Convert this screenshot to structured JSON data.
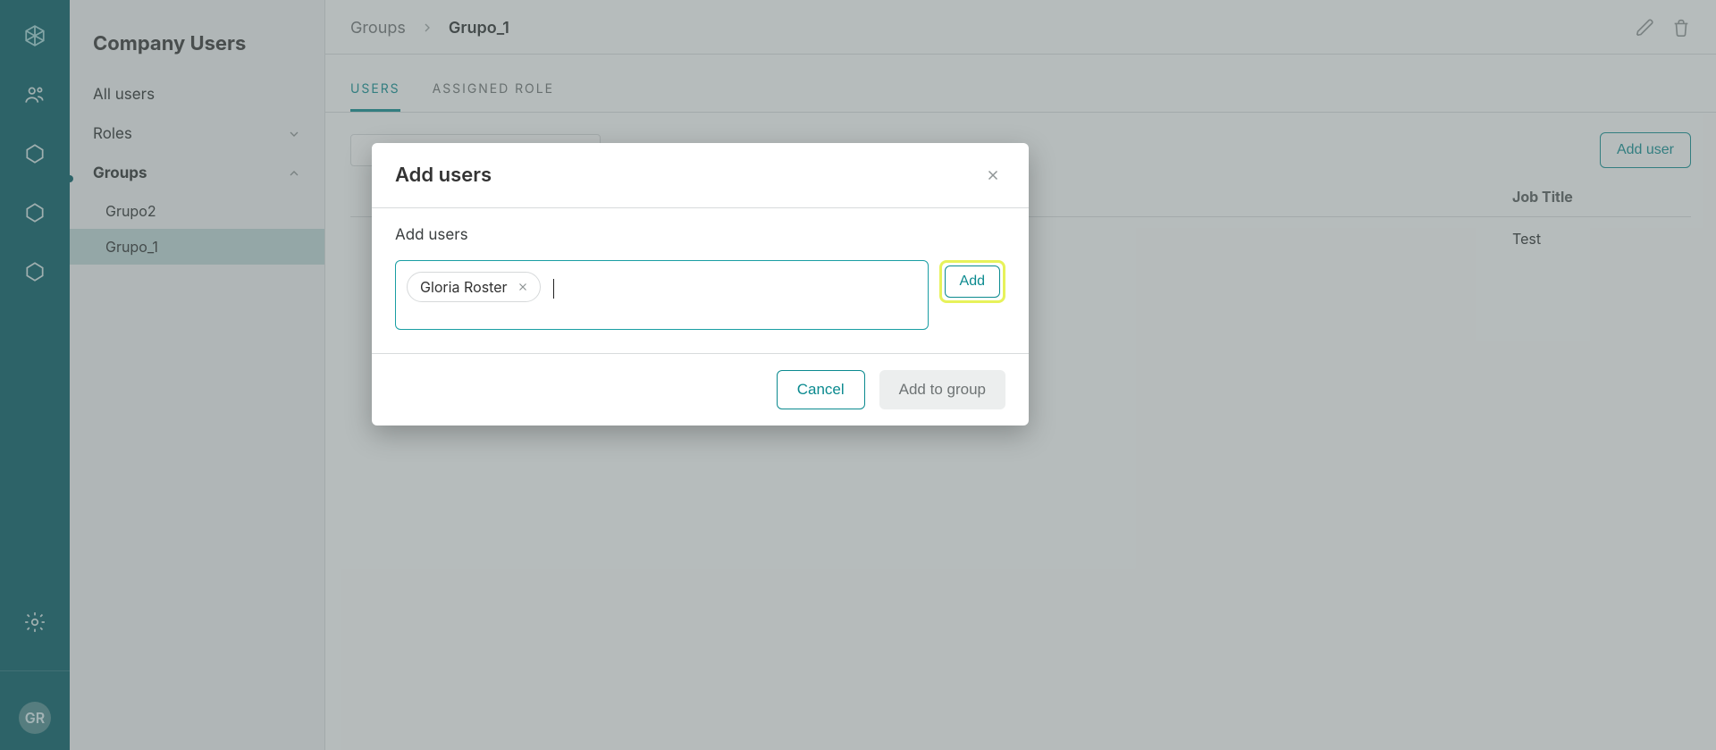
{
  "rail": {
    "avatar_initials": "GR"
  },
  "sidebar": {
    "title": "Company Users",
    "links": {
      "all_users": "All users",
      "roles": "Roles",
      "groups": "Groups"
    },
    "groups": [
      "Grupo2",
      "Grupo_1"
    ],
    "active_group": "Grupo_1"
  },
  "breadcrumb": {
    "root": "Groups",
    "current": "Grupo_1"
  },
  "tabs": {
    "users": "USERS",
    "assigned_role": "ASSIGNED ROLE"
  },
  "toolbar": {
    "add_user": "Add user"
  },
  "table": {
    "headers": {
      "job_title": "Job Title"
    },
    "rows": [
      {
        "job_title": "Test"
      }
    ]
  },
  "dialog": {
    "title": "Add users",
    "label": "Add users",
    "chip": "Gloria Roster",
    "add": "Add",
    "cancel": "Cancel",
    "add_to_group": "Add to group"
  }
}
